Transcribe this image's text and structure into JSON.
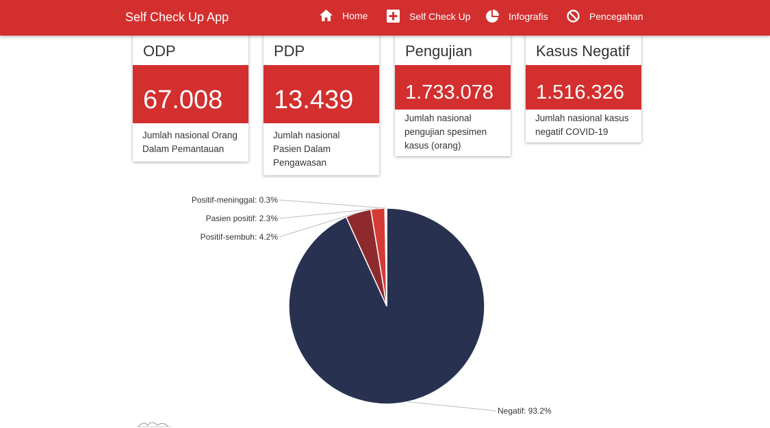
{
  "app": {
    "title": "Self Check Up App"
  },
  "nav": [
    {
      "label": "Home",
      "icon": "home-icon"
    },
    {
      "label": "Self Check Up",
      "icon": "medical-cross-icon"
    },
    {
      "label": "Infografis",
      "icon": "pie-chart-icon"
    },
    {
      "label": "Pencegahan",
      "icon": "block-icon"
    }
  ],
  "cards": [
    {
      "title": "ODP",
      "value": "67.008",
      "desc": "Jumlah nasional Orang Dalam Pemantauan"
    },
    {
      "title": "PDP",
      "value": "13.439",
      "desc": "Jumlah nasional Pasien Dalam Pengawasan"
    },
    {
      "title": "Pengujian",
      "value": "1.733.078",
      "desc": "Jumlah nasional pengujian spesimen kasus (orang)"
    },
    {
      "title": "Kasus Negatif",
      "value": "1.516.326",
      "desc": "Jumlah nasional kasus negatif COVID-19"
    }
  ],
  "chart_data": {
    "type": "pie",
    "slices": [
      {
        "label": "Negatif",
        "value": 93.2,
        "label_text": "Negatif: 93.2%",
        "color": "#283250"
      },
      {
        "label": "Positif-sembuh",
        "value": 4.2,
        "label_text": "Positif-sembuh: 4.2%",
        "color": "#8e2a2e"
      },
      {
        "label": "Pasien positif",
        "value": 2.3,
        "label_text": "Pasien positif: 2.3%",
        "color": "#d63a35"
      },
      {
        "label": "Positif-meninggal",
        "value": 0.3,
        "label_text": "Positif-meninggal: 0.3%",
        "color": "#e8e8e8"
      }
    ]
  },
  "colors": {
    "accent": "#d32f2f",
    "navy": "#283250"
  }
}
